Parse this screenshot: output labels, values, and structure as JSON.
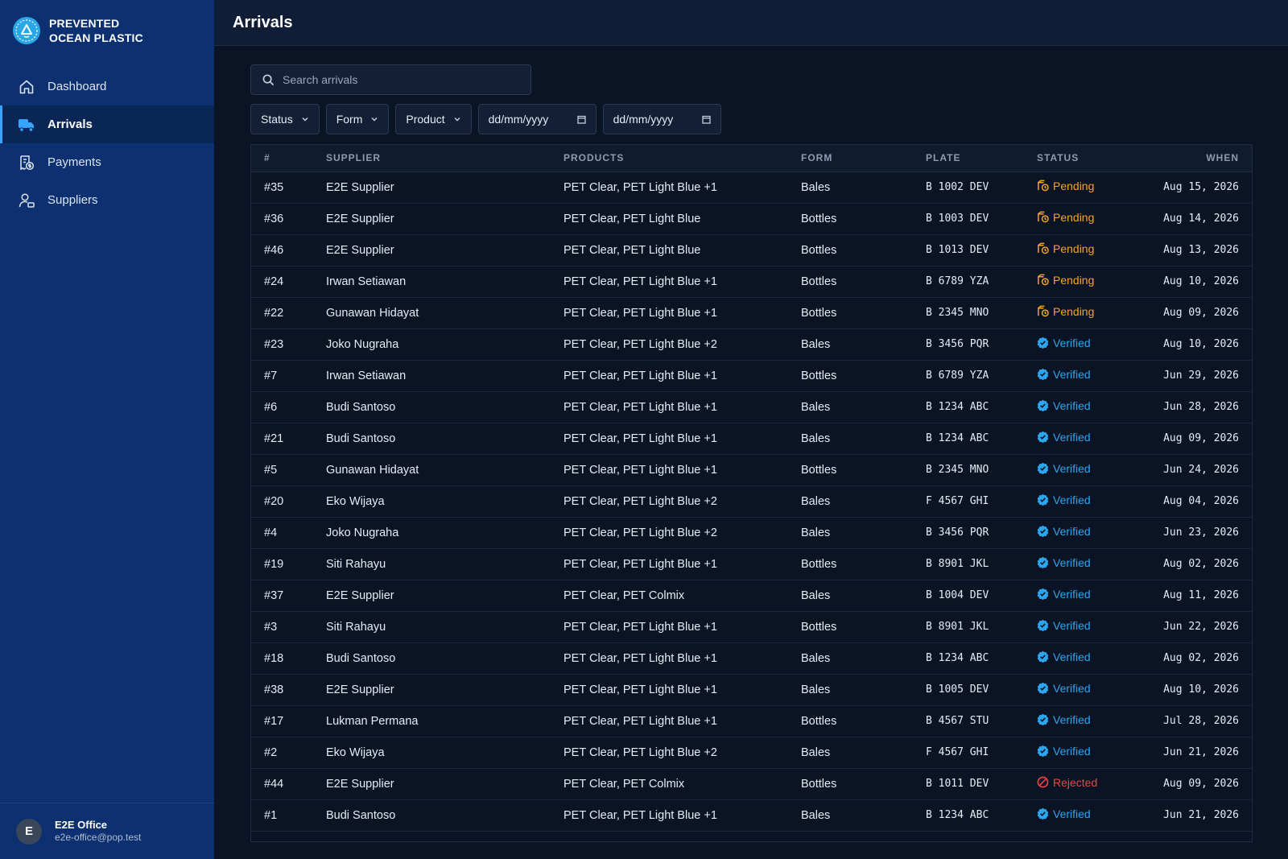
{
  "brand": {
    "line1": "PREVENTED",
    "line2": "OCEAN PLASTIC"
  },
  "nav": [
    {
      "label": "Dashboard",
      "icon": "home-icon",
      "active": false
    },
    {
      "label": "Arrivals",
      "icon": "truck-icon",
      "active": true
    },
    {
      "label": "Payments",
      "icon": "receipt-icon",
      "active": false
    },
    {
      "label": "Suppliers",
      "icon": "user-icon",
      "active": false
    }
  ],
  "user": {
    "initial": "E",
    "name": "E2E Office",
    "email": "e2e-office@pop.test"
  },
  "header": {
    "title": "Arrivals"
  },
  "search": {
    "placeholder": "Search arrivals"
  },
  "filters": {
    "status": "Status",
    "form": "Form",
    "product": "Product",
    "date_from": "dd/mm/yyyy",
    "date_to": "dd/mm/yyyy"
  },
  "colors": {
    "sidebar": "#0d3170",
    "pending": "#f5a524",
    "verified": "#2ca6f0",
    "rejected": "#ef4444"
  },
  "table": {
    "headers": [
      "#",
      "SUPPLIER",
      "PRODUCTS",
      "FORM",
      "PLATE",
      "STATUS",
      "WHEN"
    ],
    "rows": [
      {
        "id": "#35",
        "supplier": "E2E Supplier",
        "products": "PET Clear, PET Light Blue +1",
        "form": "Bales",
        "plate": "B 1002 DEV",
        "status": "Pending",
        "when": "Aug 15, 2026"
      },
      {
        "id": "#36",
        "supplier": "E2E Supplier",
        "products": "PET Clear, PET Light Blue",
        "form": "Bottles",
        "plate": "B 1003 DEV",
        "status": "Pending",
        "when": "Aug 14, 2026"
      },
      {
        "id": "#46",
        "supplier": "E2E Supplier",
        "products": "PET Clear, PET Light Blue",
        "form": "Bottles",
        "plate": "B 1013 DEV",
        "status": "Pending",
        "when": "Aug 13, 2026"
      },
      {
        "id": "#24",
        "supplier": "Irwan Setiawan",
        "products": "PET Clear, PET Light Blue +1",
        "form": "Bottles",
        "plate": "B 6789 YZA",
        "status": "Pending",
        "when": "Aug 10, 2026"
      },
      {
        "id": "#22",
        "supplier": "Gunawan Hidayat",
        "products": "PET Clear, PET Light Blue +1",
        "form": "Bottles",
        "plate": "B 2345 MNO",
        "status": "Pending",
        "when": "Aug 09, 2026"
      },
      {
        "id": "#23",
        "supplier": "Joko Nugraha",
        "products": "PET Clear, PET Light Blue +2",
        "form": "Bales",
        "plate": "B 3456 PQR",
        "status": "Verified",
        "when": "Aug 10, 2026"
      },
      {
        "id": "#7",
        "supplier": "Irwan Setiawan",
        "products": "PET Clear, PET Light Blue +1",
        "form": "Bottles",
        "plate": "B 6789 YZA",
        "status": "Verified",
        "when": "Jun 29, 2026"
      },
      {
        "id": "#6",
        "supplier": "Budi Santoso",
        "products": "PET Clear, PET Light Blue +1",
        "form": "Bales",
        "plate": "B 1234 ABC",
        "status": "Verified",
        "when": "Jun 28, 2026"
      },
      {
        "id": "#21",
        "supplier": "Budi Santoso",
        "products": "PET Clear, PET Light Blue +1",
        "form": "Bales",
        "plate": "B 1234 ABC",
        "status": "Verified",
        "when": "Aug 09, 2026"
      },
      {
        "id": "#5",
        "supplier": "Gunawan Hidayat",
        "products": "PET Clear, PET Light Blue +1",
        "form": "Bottles",
        "plate": "B 2345 MNO",
        "status": "Verified",
        "when": "Jun 24, 2026"
      },
      {
        "id": "#20",
        "supplier": "Eko Wijaya",
        "products": "PET Clear, PET Light Blue +2",
        "form": "Bales",
        "plate": "F 4567 GHI",
        "status": "Verified",
        "when": "Aug 04, 2026"
      },
      {
        "id": "#4",
        "supplier": "Joko Nugraha",
        "products": "PET Clear, PET Light Blue +2",
        "form": "Bales",
        "plate": "B 3456 PQR",
        "status": "Verified",
        "when": "Jun 23, 2026"
      },
      {
        "id": "#19",
        "supplier": "Siti Rahayu",
        "products": "PET Clear, PET Light Blue +1",
        "form": "Bottles",
        "plate": "B 8901 JKL",
        "status": "Verified",
        "when": "Aug 02, 2026"
      },
      {
        "id": "#37",
        "supplier": "E2E Supplier",
        "products": "PET Clear, PET Colmix",
        "form": "Bales",
        "plate": "B 1004 DEV",
        "status": "Verified",
        "when": "Aug 11, 2026"
      },
      {
        "id": "#3",
        "supplier": "Siti Rahayu",
        "products": "PET Clear, PET Light Blue +1",
        "form": "Bottles",
        "plate": "B 8901 JKL",
        "status": "Verified",
        "when": "Jun 22, 2026"
      },
      {
        "id": "#18",
        "supplier": "Budi Santoso",
        "products": "PET Clear, PET Light Blue +1",
        "form": "Bales",
        "plate": "B 1234 ABC",
        "status": "Verified",
        "when": "Aug 02, 2026"
      },
      {
        "id": "#38",
        "supplier": "E2E Supplier",
        "products": "PET Clear, PET Light Blue +1",
        "form": "Bales",
        "plate": "B 1005 DEV",
        "status": "Verified",
        "when": "Aug 10, 2026"
      },
      {
        "id": "#17",
        "supplier": "Lukman Permana",
        "products": "PET Clear, PET Light Blue +1",
        "form": "Bottles",
        "plate": "B 4567 STU",
        "status": "Verified",
        "when": "Jul 28, 2026"
      },
      {
        "id": "#2",
        "supplier": "Eko Wijaya",
        "products": "PET Clear, PET Light Blue +2",
        "form": "Bales",
        "plate": "F 4567 GHI",
        "status": "Verified",
        "when": "Jun 21, 2026"
      },
      {
        "id": "#44",
        "supplier": "E2E Supplier",
        "products": "PET Clear, PET Colmix",
        "form": "Bottles",
        "plate": "B 1011 DEV",
        "status": "Rejected",
        "when": "Aug 09, 2026"
      },
      {
        "id": "#1",
        "supplier": "Budi Santoso",
        "products": "PET Clear, PET Light Blue +1",
        "form": "Bales",
        "plate": "B 1234 ABC",
        "status": "Verified",
        "when": "Jun 21, 2026"
      }
    ]
  }
}
